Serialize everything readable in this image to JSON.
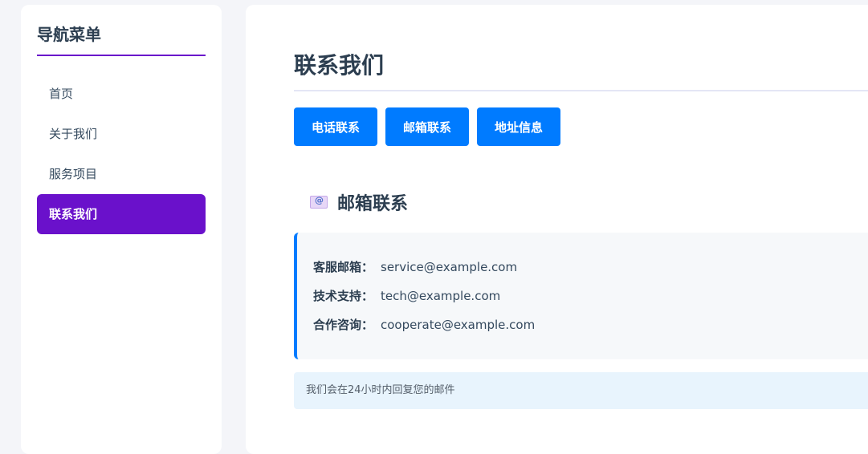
{
  "sidebar": {
    "title": "导航菜单",
    "items": [
      {
        "label": "首页"
      },
      {
        "label": "关于我们"
      },
      {
        "label": "服务项目"
      },
      {
        "label": "联系我们"
      }
    ],
    "active_index": 3
  },
  "main": {
    "title": "联系我们",
    "tabs": [
      {
        "label": "电话联系"
      },
      {
        "label": "邮箱联系"
      },
      {
        "label": "地址信息"
      }
    ],
    "section": {
      "icon": "mail-icon",
      "heading": "邮箱联系",
      "rows": [
        {
          "label": "客服邮箱：",
          "value": "service@example.com"
        },
        {
          "label": "技术支持：",
          "value": "tech@example.com"
        },
        {
          "label": "合作咨询：",
          "value": "cooperate@example.com"
        }
      ],
      "note": "我们会在24小时内回复您的邮件"
    }
  },
  "colors": {
    "accent_purple": "#6a11cb",
    "button_blue": "#007bff",
    "note_background": "#e8f4fd"
  }
}
